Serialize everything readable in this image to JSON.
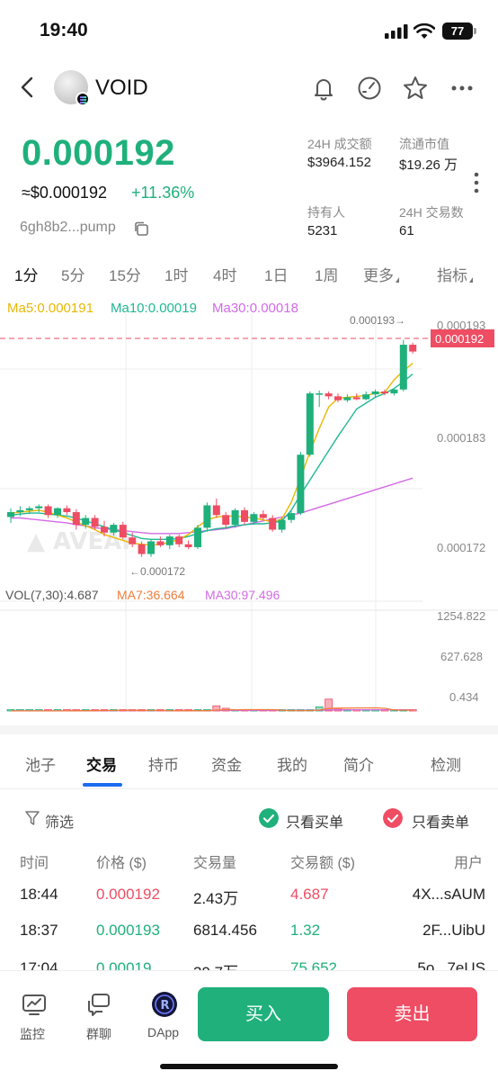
{
  "status_bar": {
    "time": "19:40",
    "battery": "77"
  },
  "header": {
    "coin_name": "VOID",
    "icons": [
      "back-icon",
      "bell-icon",
      "gauge-icon",
      "star-icon",
      "more-icon"
    ]
  },
  "price": {
    "main": "0.000192",
    "usd": "≈$0.000192",
    "change": "+11.36%",
    "address": "6gh8b2...pump",
    "up_color": "#1fb07c",
    "down_color": "#ee4d63"
  },
  "stats": {
    "volume_label": "24H 成交额",
    "volume_value": "$3964.152",
    "mcap_label": "流通市值",
    "mcap_value": "$19.26 万",
    "holders_label": "持有人",
    "holders_value": "5231",
    "tx_label": "24H 交易数",
    "tx_value": "61"
  },
  "timeframes": [
    "1分",
    "5分",
    "15分",
    "1时",
    "4时",
    "1日",
    "1周",
    "更多",
    "指标"
  ],
  "ma": {
    "ma5": "Ma5:0.000191",
    "ma10": "Ma10:0.00019",
    "ma30": "Ma30:0.00018"
  },
  "chart_labels": {
    "current_price": "0.000192",
    "high_marker": "0.000193→",
    "low_marker": "←0.000172",
    "y_ticks": [
      "0.000193",
      "0.000183",
      "0.000172"
    ],
    "vol_ticks": [
      "1254.822",
      "627.628",
      "0.434"
    ]
  },
  "vol": {
    "label": "VOL(7,30):4.687",
    "ma7": "MA7:36.664",
    "ma30": "MA30:97.496"
  },
  "chart_data": {
    "type": "candlestick",
    "y_range": [
      0.0001685,
      0.0001955
    ],
    "candles": [
      [
        0.0001753,
        0.0001762,
        0.0001747,
        0.0001758
      ],
      [
        0.0001758,
        0.0001764,
        0.0001754,
        0.000176
      ],
      [
        0.000176,
        0.0001764,
        0.0001756,
        0.0001762
      ],
      [
        0.0001762,
        0.0001766,
        0.0001758,
        0.0001764
      ],
      [
        0.0001764,
        0.0001766,
        0.0001752,
        0.0001755
      ],
      [
        0.0001755,
        0.0001763,
        0.0001752,
        0.0001762
      ],
      [
        0.0001762,
        0.0001765,
        0.0001755,
        0.0001758
      ],
      [
        0.0001758,
        0.0001761,
        0.000174,
        0.0001745
      ],
      [
        0.0001745,
        0.0001755,
        0.0001741,
        0.0001752
      ],
      [
        0.0001752,
        0.0001755,
        0.000174,
        0.0001743
      ],
      [
        0.0001743,
        0.0001749,
        0.0001733,
        0.0001737
      ],
      [
        0.0001737,
        0.0001747,
        0.0001734,
        0.0001745
      ],
      [
        0.0001745,
        0.0001748,
        0.000173,
        0.0001732
      ],
      [
        0.0001732,
        0.0001737,
        0.0001722,
        0.0001725
      ],
      [
        0.0001725,
        0.0001728,
        0.0001712,
        0.0001715
      ],
      [
        0.0001715,
        0.000173,
        0.0001712,
        0.0001728
      ],
      [
        0.0001728,
        0.0001733,
        0.0001722,
        0.0001724
      ],
      [
        0.0001724,
        0.0001735,
        0.000172,
        0.0001733
      ],
      [
        0.0001733,
        0.0001735,
        0.0001722,
        0.0001725
      ],
      [
        0.0001725,
        0.0001729,
        0.000172,
        0.0001722
      ],
      [
        0.0001722,
        0.0001745,
        0.000172,
        0.0001742
      ],
      [
        0.0001742,
        0.0001768,
        0.0001738,
        0.0001765
      ],
      [
        0.0001765,
        0.0001772,
        0.0001752,
        0.0001755
      ],
      [
        0.0001755,
        0.0001758,
        0.0001742,
        0.0001745
      ],
      [
        0.0001745,
        0.0001762,
        0.0001742,
        0.000176
      ],
      [
        0.000176,
        0.0001763,
        0.0001745,
        0.0001748
      ],
      [
        0.0001748,
        0.0001758,
        0.0001745,
        0.0001756
      ],
      [
        0.0001756,
        0.000176,
        0.000175,
        0.0001752
      ],
      [
        0.0001752,
        0.0001755,
        0.0001738,
        0.000174
      ],
      [
        0.000174,
        0.0001752,
        0.0001737,
        0.000175
      ],
      [
        0.000175,
        0.000176,
        0.0001747,
        0.0001757
      ],
      [
        0.0001757,
        0.000182,
        0.0001755,
        0.0001817
      ],
      [
        0.0001817,
        0.0001882,
        0.0001815,
        0.000188
      ],
      [
        0.000188,
        0.0001883,
        0.0001866,
        0.000188
      ],
      [
        0.000188,
        0.0001882,
        0.0001874,
        0.0001877
      ],
      [
        0.0001877,
        0.000188,
        0.0001871,
        0.0001873
      ],
      [
        0.0001873,
        0.0001879,
        0.0001871,
        0.0001876
      ],
      [
        0.0001876,
        0.000188,
        0.0001873,
        0.0001874
      ],
      [
        0.0001874,
        0.0001882,
        0.0001873,
        0.0001879
      ],
      [
        0.0001879,
        0.0001884,
        0.0001876,
        0.0001882
      ],
      [
        0.0001882,
        0.0001884,
        0.0001878,
        0.000188
      ],
      [
        0.000188,
        0.0001885,
        0.0001878,
        0.0001884
      ],
      [
        0.0001884,
        0.0001935,
        0.0001882,
        0.000193
      ],
      [
        0.000193,
        0.0001932,
        0.0001921,
        0.0001923
      ]
    ],
    "ma5": [
      0.0001757,
      0.0001758,
      0.0001759,
      0.000176,
      0.0001758,
      0.0001755,
      0.0001752,
      0.0001748,
      0.0001744,
      0.000174,
      0.0001735,
      0.0001732,
      0.0001729,
      0.0001726,
      0.0001725,
      0.0001724,
      0.0001725,
      0.0001727,
      0.000173,
      0.0001735,
      0.0001743,
      0.000175,
      0.0001753,
      0.0001754,
      0.0001754,
      0.0001753,
      0.0001752,
      0.000175,
      0.0001748,
      0.0001751,
      0.0001768,
      0.0001793,
      0.000182,
      0.0001844,
      0.0001866,
      0.0001875,
      0.0001876,
      0.0001877,
      0.0001878,
      0.000188,
      0.0001881,
      0.0001894,
      0.0001903,
      0.0001911
    ],
    "ma10": [
      0.0001755,
      0.0001756,
      0.0001757,
      0.0001757,
      0.0001756,
      0.0001755,
      0.0001754,
      0.0001752,
      0.0001749,
      0.0001746,
      0.0001743,
      0.000174,
      0.0001737,
      0.0001734,
      0.0001731,
      0.000173,
      0.000173,
      0.000173,
      0.0001731,
      0.0001733,
      0.0001736,
      0.0001739,
      0.0001741,
      0.0001742,
      0.0001744,
      0.0001745,
      0.0001746,
      0.0001746,
      0.0001747,
      0.0001749,
      0.000176,
      0.0001776,
      0.0001791,
      0.0001806,
      0.0001821,
      0.0001836,
      0.000185,
      0.0001864,
      0.000187,
      0.0001876,
      0.000188,
      0.0001885,
      0.0001892,
      0.00019
    ],
    "ma30": [
      0.0001752,
      0.0001752,
      0.0001751,
      0.000175,
      0.0001749,
      0.0001748,
      0.0001747,
      0.0001745,
      0.0001744,
      0.0001742,
      0.0001741,
      0.000174,
      0.0001739,
      0.0001738,
      0.0001737,
      0.0001736,
      0.0001736,
      0.0001736,
      0.0001736,
      0.0001737,
      0.0001738,
      0.0001739,
      0.000174,
      0.0001741,
      0.0001743,
      0.0001745,
      0.0001747,
      0.0001749,
      0.0001751,
      0.0001753,
      0.0001755,
      0.0001757,
      0.000176,
      0.0001763,
      0.0001766,
      0.0001769,
      0.0001772,
      0.0001775,
      0.0001778,
      0.0001781,
      0.0001784,
      0.0001787,
      0.000179,
      0.0001793
    ],
    "volume": [
      2,
      1,
      1,
      1,
      1,
      2,
      1,
      14,
      1,
      10,
      9,
      11,
      2,
      1,
      8,
      6,
      2,
      1,
      1,
      1,
      3,
      6,
      64,
      34,
      4,
      4,
      3,
      6,
      5,
      8,
      1,
      8,
      1,
      52,
      148,
      30,
      8,
      16,
      12,
      12,
      7,
      5,
      15,
      10
    ],
    "volume_range": [
      0,
      1254.822
    ]
  },
  "tabs": [
    "池子",
    "交易",
    "持币",
    "资金",
    "我的",
    "简介",
    "检测"
  ],
  "filter": {
    "label": "筛选",
    "buy_only": "只看买单",
    "sell_only": "只看卖单"
  },
  "table": {
    "headers": [
      "时间",
      "价格 ($)",
      "交易量",
      "交易额 ($)",
      "用户"
    ],
    "rows": [
      {
        "time": "18:44",
        "price": "0.000192",
        "qty": "2.43万",
        "amount": "4.687",
        "user": "4X...sAUM",
        "side": "sell"
      },
      {
        "time": "18:37",
        "price": "0.000193",
        "qty": "6814.456",
        "amount": "1.32",
        "user": "2F...UibU",
        "side": "buy"
      },
      {
        "time": "17:04",
        "price": "0.00019",
        "qty": "39.7万",
        "amount": "75.652",
        "user": "5o...7eUS",
        "side": "buy"
      }
    ]
  },
  "bottom": {
    "monitor": "监控",
    "group_chat": "群聊",
    "dapp": "DApp",
    "buy": "买入",
    "sell": "卖出"
  }
}
